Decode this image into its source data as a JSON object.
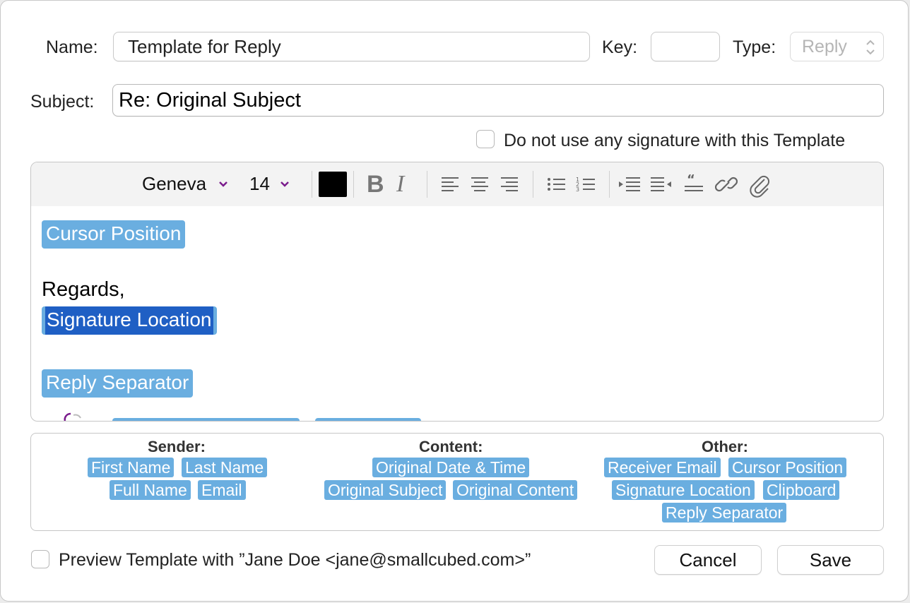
{
  "form": {
    "name_label": "Name:",
    "name_value": "Template for Reply",
    "key_label": "Key:",
    "key_value": "",
    "type_label": "Type:",
    "type_value": "Reply",
    "subject_label": "Subject:",
    "subject_value": "Re: Original Subject",
    "no_signature_label": "Do not use any signature with this Template",
    "no_signature_checked": false
  },
  "toolbar": {
    "font_family": "Geneva",
    "font_size": "14",
    "text_color": "#000000",
    "bold_glyph": "B",
    "italic_glyph": "I",
    "icons": [
      "align-left-icon",
      "align-center-icon",
      "align-right-icon",
      "bullet-list-icon",
      "numbered-list-icon",
      "indent-icon",
      "outdent-icon",
      "quote-icon",
      "link-icon",
      "attachment-icon"
    ]
  },
  "editor": {
    "token_cursor": "Cursor Position",
    "regards": "Regards,",
    "token_signature": "Signature Location",
    "token_reply_separator": "Reply Separator"
  },
  "placeholders": {
    "sender": {
      "heading": "Sender:",
      "items": [
        "First Name",
        "Last Name",
        "Full Name",
        "Email"
      ]
    },
    "content": {
      "heading": "Content:",
      "items": [
        "Original Date & Time",
        "Original Subject",
        "Original Content"
      ]
    },
    "other": {
      "heading": "Other:",
      "items": [
        "Receiver Email",
        "Cursor Position",
        "Signature Location",
        "Clipboard",
        "Reply Separator"
      ]
    }
  },
  "footer": {
    "preview_label": "Preview Template with ”Jane Doe <jane@smallcubed.com>”",
    "preview_checked": false,
    "cancel_label": "Cancel",
    "save_label": "Save"
  },
  "colors": {
    "token": "#6aaee0",
    "token_selected": "#1f5fc4",
    "chevron": "#7a1b8c"
  }
}
